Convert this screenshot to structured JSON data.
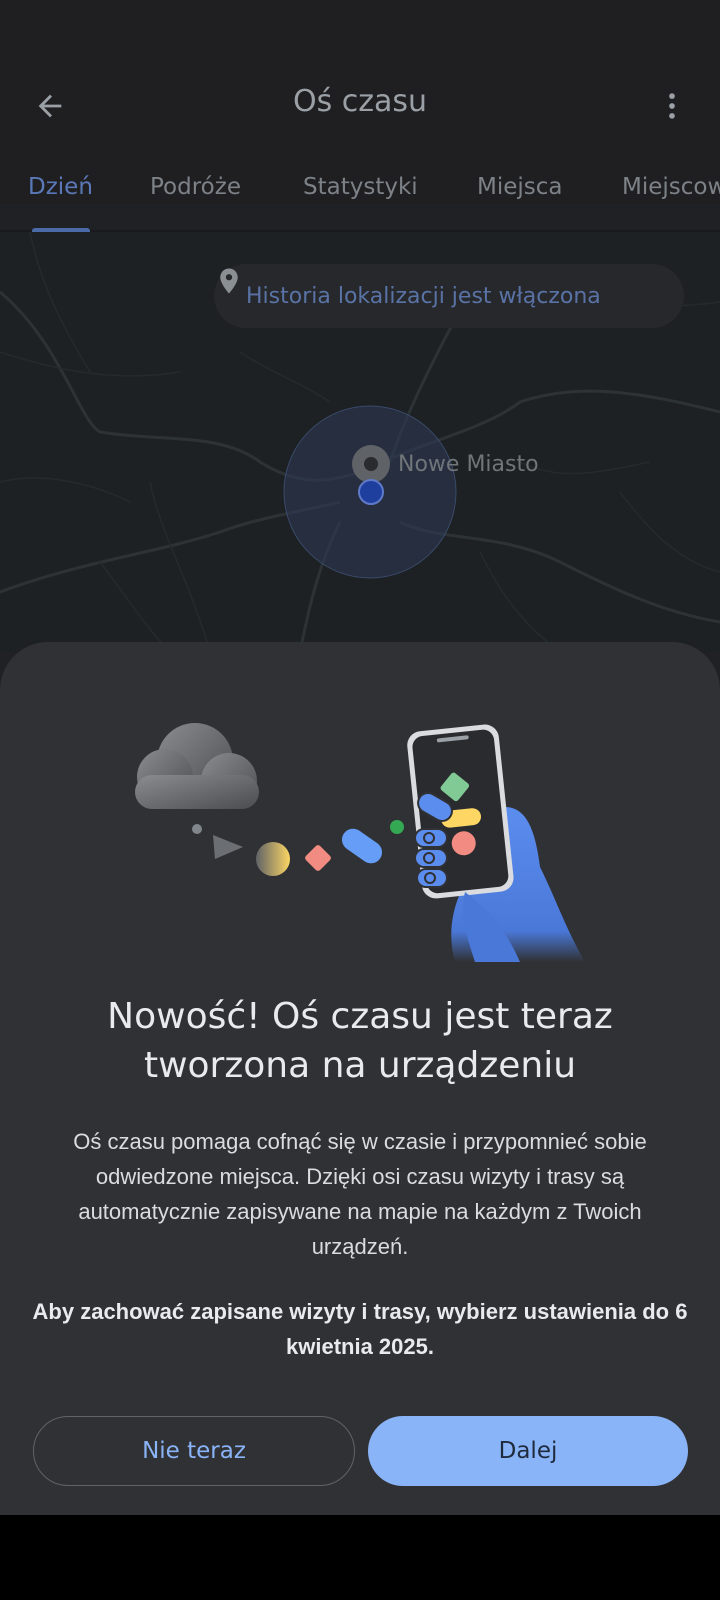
{
  "app_bar": {
    "title": "Oś czasu",
    "back_icon": "arrow-back-icon",
    "menu_icon": "more-vert-icon"
  },
  "tabs": [
    {
      "label": "Dzień",
      "active": true
    },
    {
      "label": "Podróże",
      "active": false
    },
    {
      "label": "Statystyki",
      "active": false
    },
    {
      "label": "Miejsca",
      "active": false
    },
    {
      "label": "Miejscowości",
      "active": false
    }
  ],
  "map": {
    "chip_text": "Historia lokalizacji jest włączona",
    "chip_icon": "location-pin-icon",
    "place_name": "Nowe Miasto"
  },
  "sheet": {
    "headline": "Nowość! Oś czasu jest teraz tworzona na urządzeniu",
    "body": "Oś czasu pomaga cofnąć się w czasie i przypomnieć sobie odwiedzone miejsca. Dzięki osi czasu wizyty i trasy są automatycznie zapisywane na mapie na każdym z Twoich urządzeń.",
    "body_strong": "Aby zachować zapisane wizyty i trasy, wybierz ustawienia do 6 kwietnia 2025.",
    "secondary_button": "Nie teraz",
    "primary_button": "Dalej"
  },
  "colors": {
    "accent": "#8ab4f8",
    "surface": "#303134",
    "background": "#202124"
  }
}
